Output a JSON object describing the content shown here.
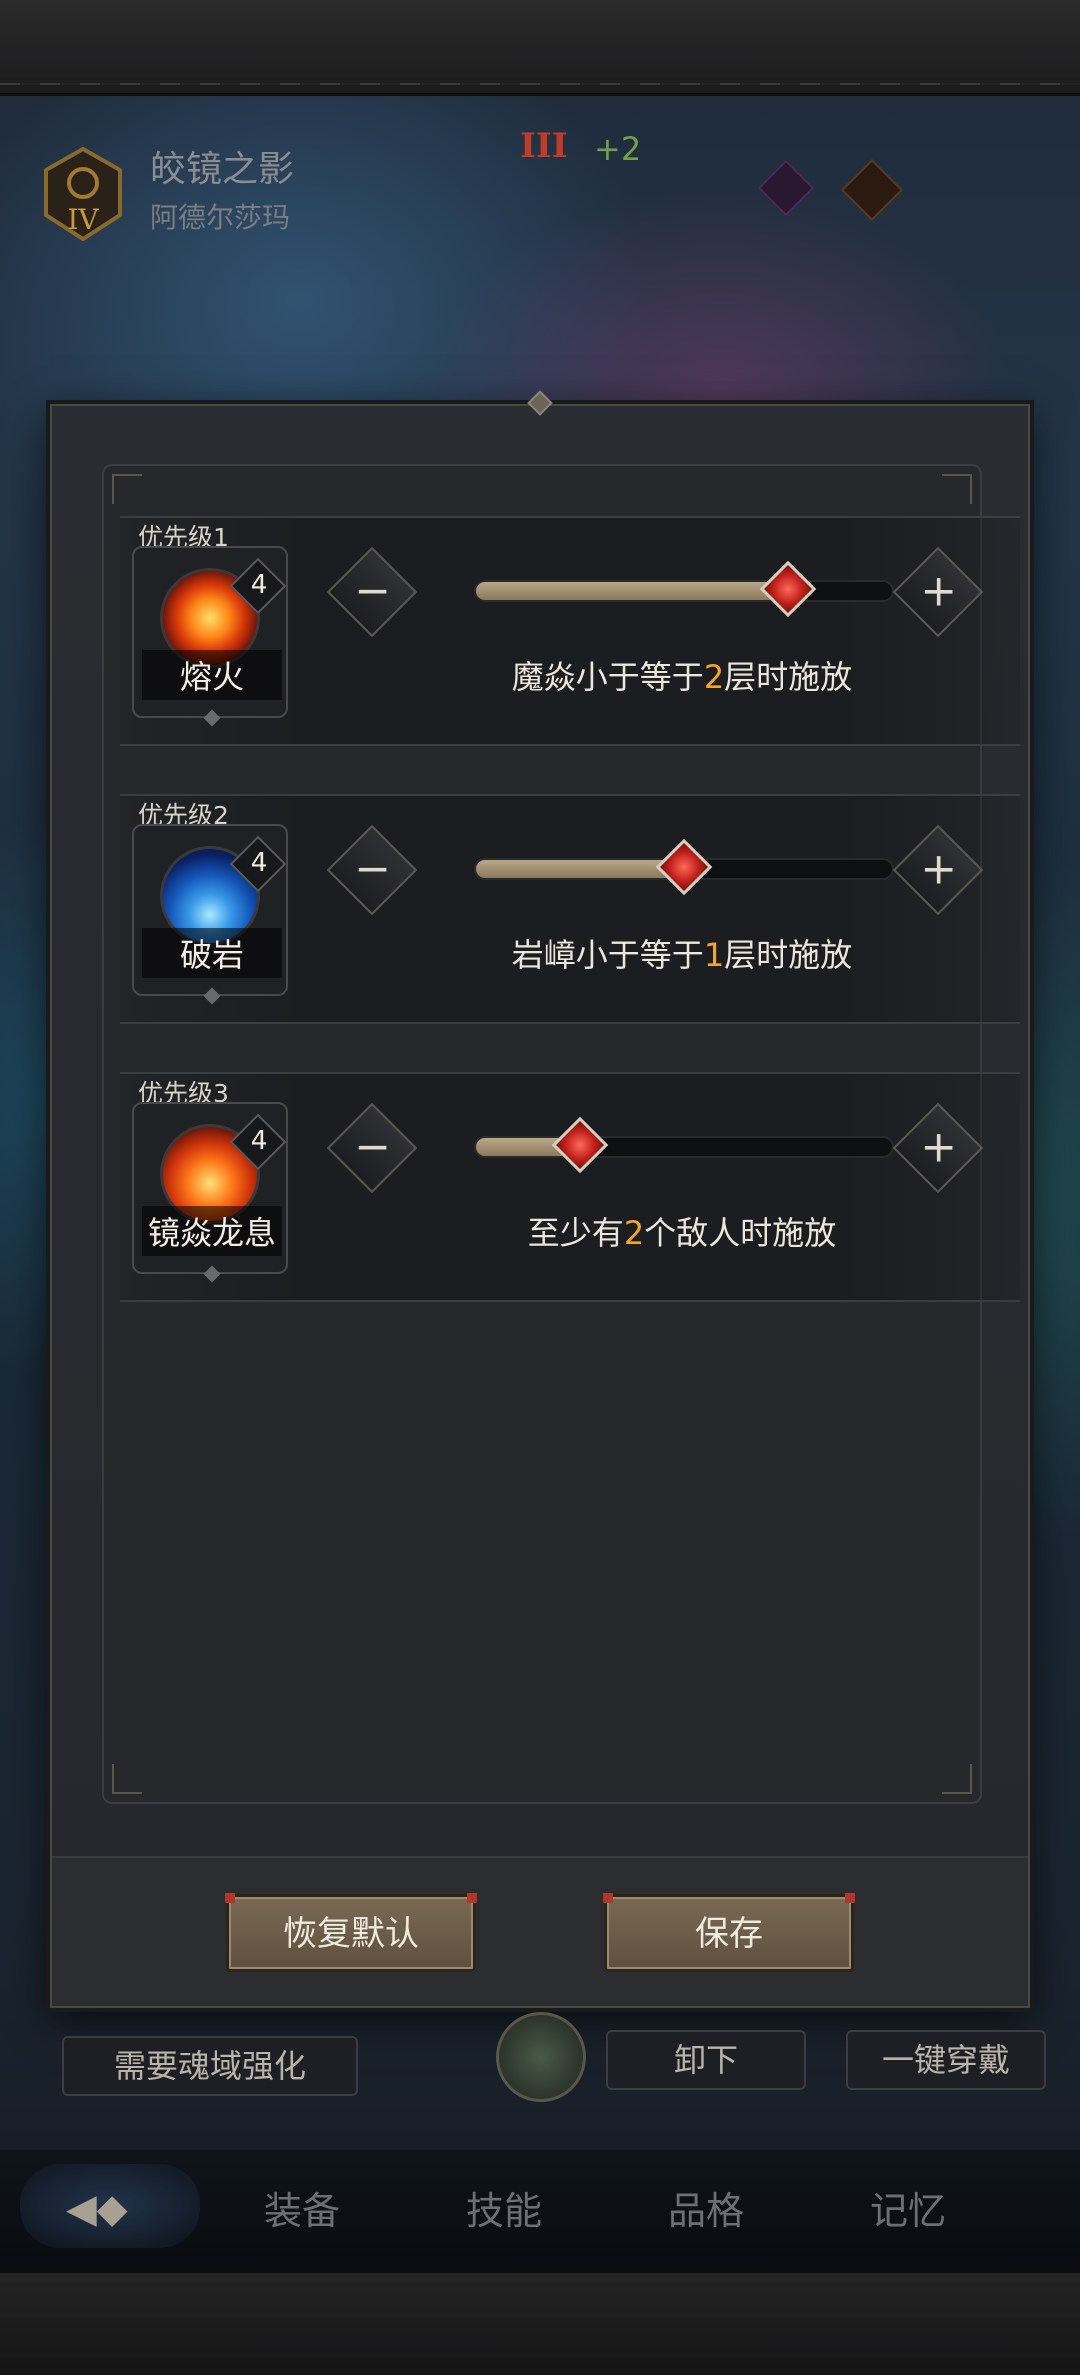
{
  "header": {
    "emblem_label": "IV",
    "title": "皎镜之影",
    "subtitle": "阿德尔莎玛",
    "rank": "III",
    "rank_bonus": "+2"
  },
  "rules": [
    {
      "priority": "优先级1",
      "skill_name": "熔火",
      "skill_level": "4",
      "orb": "fire",
      "slider_fraction": 0.75,
      "condition_before": "魔焱小于等于",
      "condition_value": "2",
      "condition_after": "层时施放"
    },
    {
      "priority": "优先级2",
      "skill_name": "破岩",
      "skill_level": "4",
      "orb": "rock",
      "slider_fraction": 0.5,
      "condition_before": "岩嶂小于等于",
      "condition_value": "1",
      "condition_after": "层时施放"
    },
    {
      "priority": "优先级3",
      "skill_name": "镜焱龙息",
      "skill_level": "4",
      "orb": "breath",
      "slider_fraction": 0.25,
      "condition_before": "至少有",
      "condition_value": "2",
      "condition_after": "个敌人时施放"
    }
  ],
  "controls": {
    "minus_label": "−",
    "plus_label": "+"
  },
  "footer": {
    "reset_label": "恢复默认",
    "save_label": "保存"
  },
  "underlay": {
    "need_enhance": "需要魂域强化",
    "unequip": "卸下",
    "equip_all": "一键穿戴"
  },
  "tabs": [
    "装备",
    "技能",
    "品格",
    "记忆"
  ],
  "colors": {
    "highlight": "#f2a62a",
    "knob": "#c0201a",
    "button": "#7a6a54"
  }
}
